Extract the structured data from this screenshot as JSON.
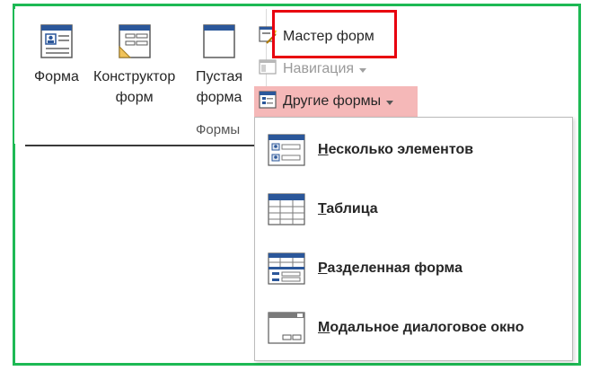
{
  "ribbon": {
    "group_label": "Формы",
    "buttons": [
      {
        "label": "Форма"
      },
      {
        "label": "Конструктор\nформ"
      },
      {
        "label": "Пустая\nформа"
      }
    ],
    "small_buttons": {
      "form_wizard": "Мастер форм",
      "navigation": "Навигация",
      "other_forms": "Другие формы"
    }
  },
  "dropdown": {
    "items": [
      {
        "label": "Несколько элементов"
      },
      {
        "label": "Таблица"
      },
      {
        "label": "Разделенная форма"
      },
      {
        "label": "Модальное диалоговое окно"
      }
    ]
  },
  "colors": {
    "frame_border": "#1db954",
    "highlight": "#e8000f",
    "selected_bg": "#f5b8b8",
    "icon_blue": "#2b579a"
  }
}
